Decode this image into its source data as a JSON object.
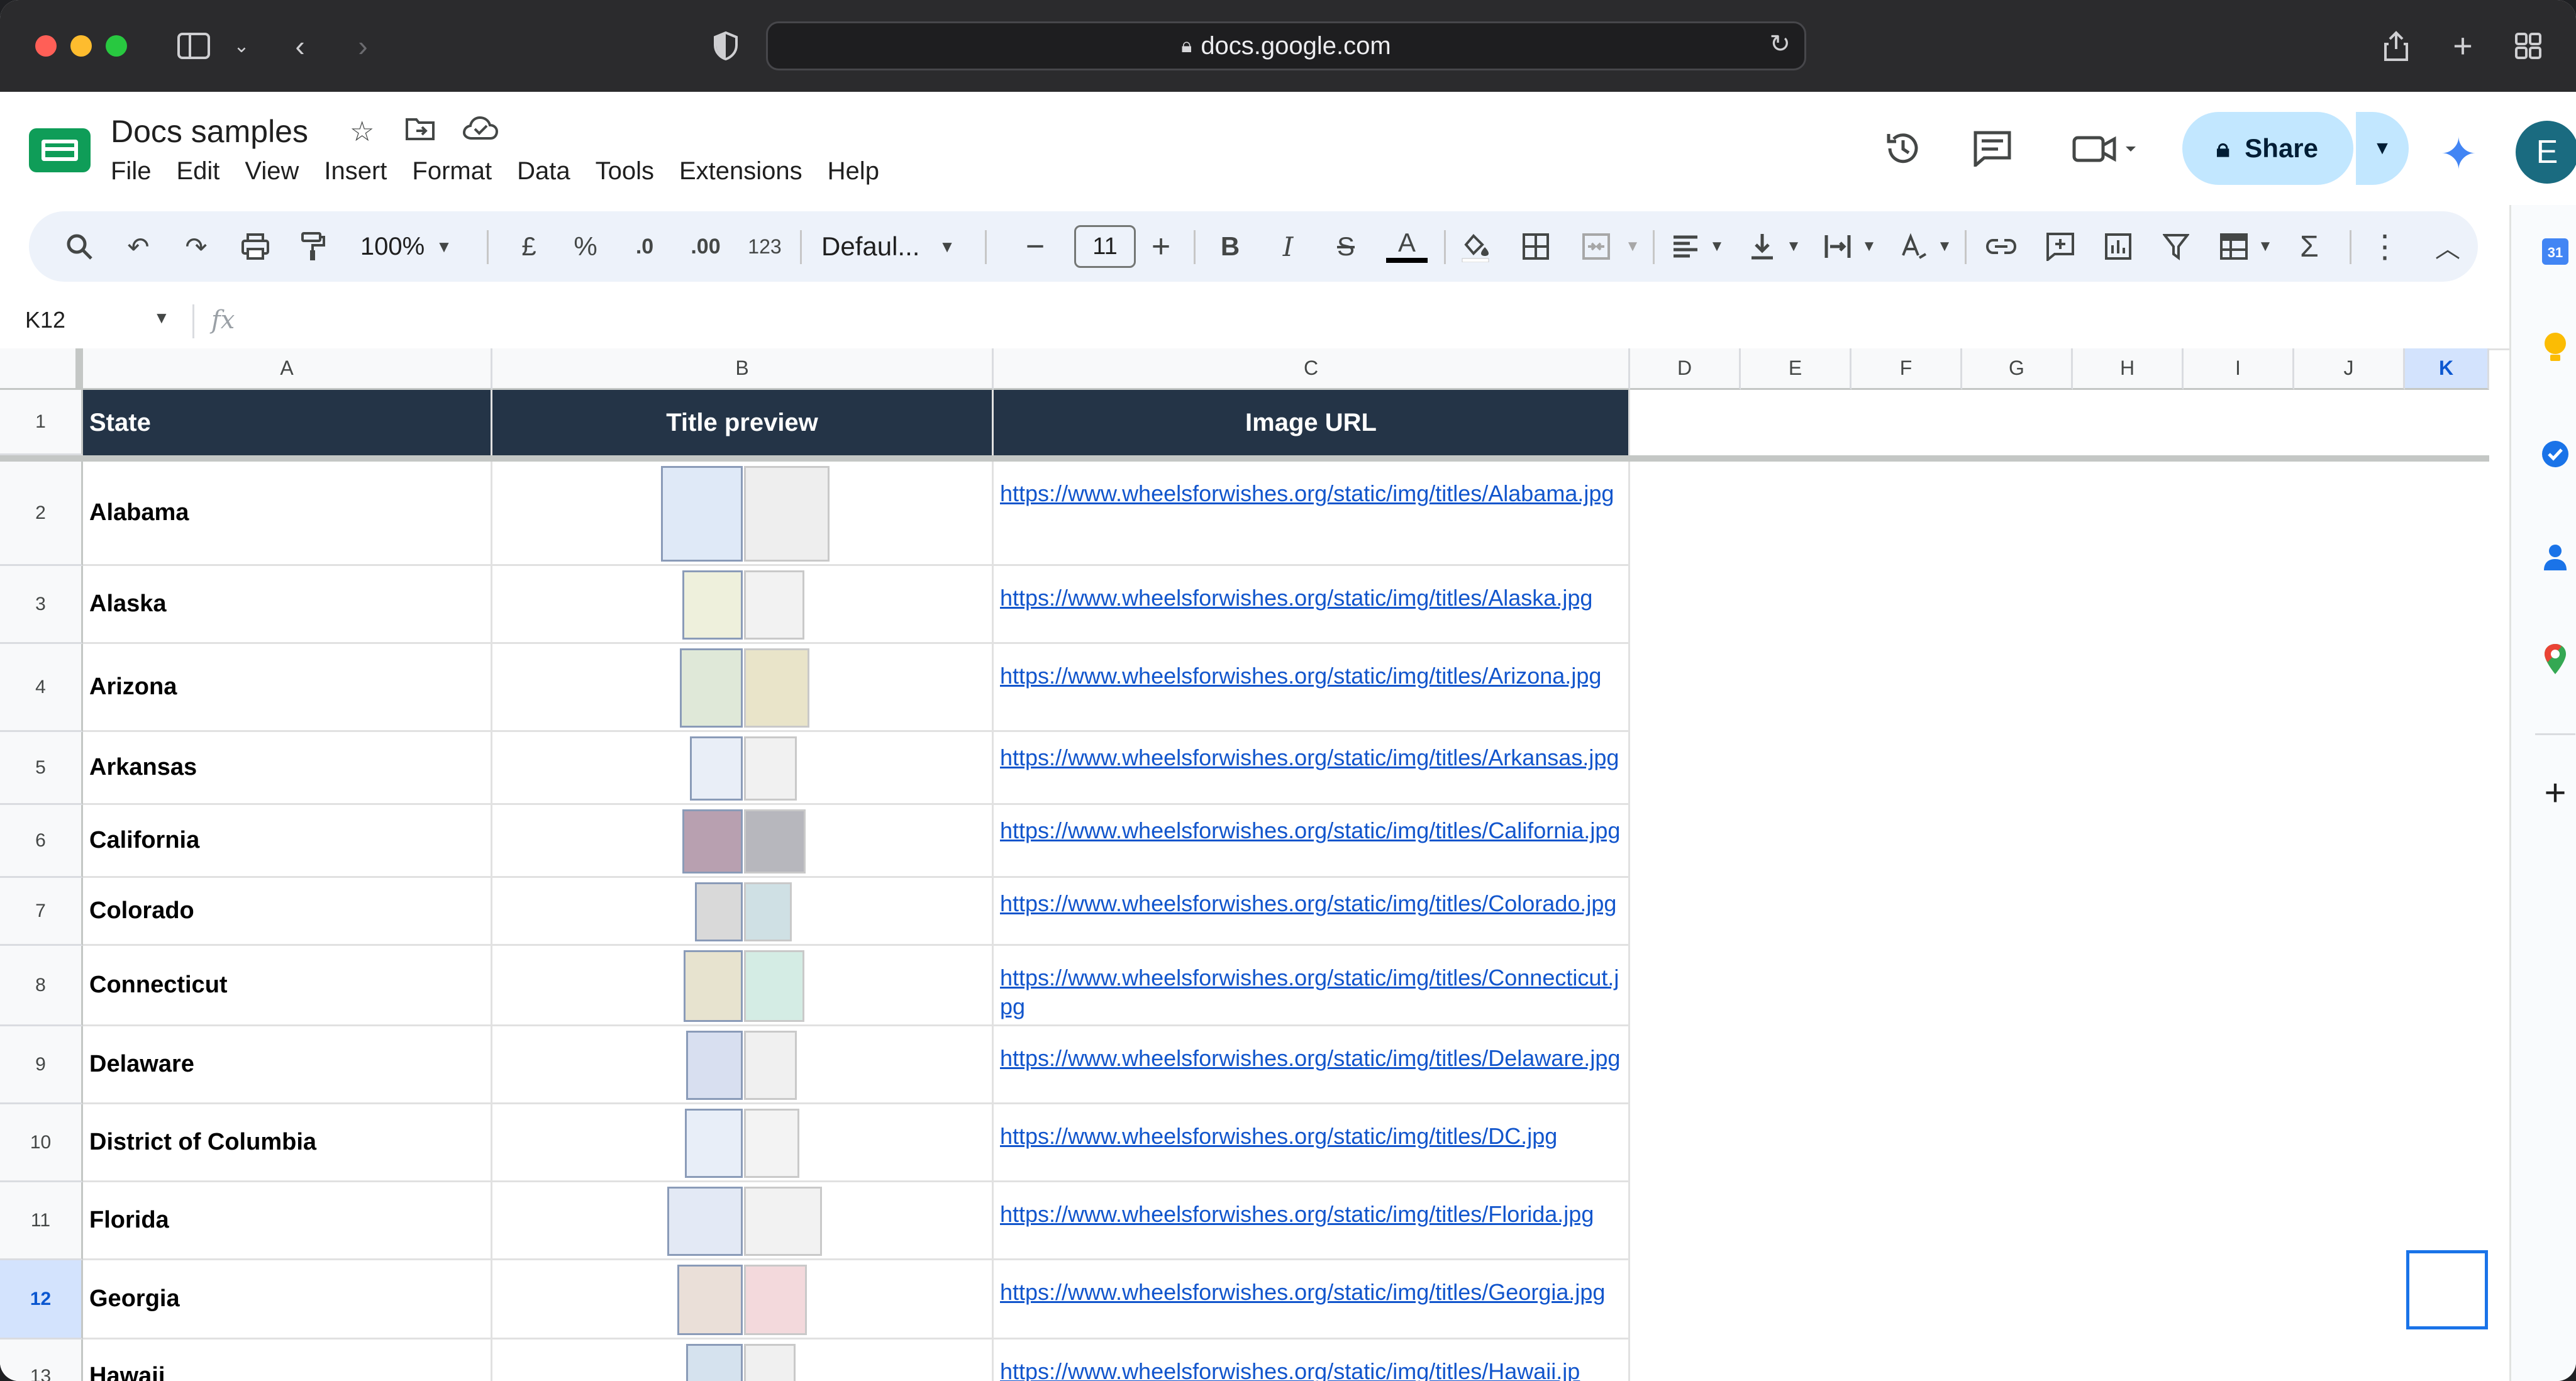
{
  "browser": {
    "url": "docs.google.com"
  },
  "app": {
    "doc_title": "Docs samples",
    "menu": [
      "File",
      "Edit",
      "View",
      "Insert",
      "Format",
      "Data",
      "Tools",
      "Extensions",
      "Help"
    ],
    "share_label": "Share",
    "avatar_letter": "E"
  },
  "toolbar": {
    "zoom": "100%",
    "currency": "£",
    "percent": "%",
    "dec_decrease": ".0",
    "dec_increase": ".00",
    "number_format": "123",
    "font": "Defaul...",
    "font_size": "11",
    "bold": "B",
    "italic": "I",
    "strike": "S",
    "text_color": "A",
    "sum": "Σ"
  },
  "formula_bar": {
    "name_box": "K12",
    "fx": "fx",
    "value": ""
  },
  "grid": {
    "columns": [
      "A",
      "B",
      "C",
      "D",
      "E",
      "F",
      "G",
      "H",
      "I",
      "J",
      "K"
    ],
    "selected_column": "K",
    "selected_row": "12",
    "header": {
      "row_num": "1",
      "state": "State",
      "title_preview": "Title preview",
      "image_url": "Image URL"
    },
    "rows": [
      {
        "num": "2",
        "state": "Alabama",
        "url": "https://www.wheelsforwishes.org/static/img/titles/Alabama.jpg"
      },
      {
        "num": "3",
        "state": "Alaska",
        "url": "https://www.wheelsforwishes.org/static/img/titles/Alaska.jpg"
      },
      {
        "num": "4",
        "state": "Arizona",
        "url": "https://www.wheelsforwishes.org/static/img/titles/Arizona.jpg"
      },
      {
        "num": "5",
        "state": "Arkansas",
        "url": "https://www.wheelsforwishes.org/static/img/titles/Arkansas.jpg"
      },
      {
        "num": "6",
        "state": "California",
        "url": "https://www.wheelsforwishes.org/static/img/titles/California.jpg"
      },
      {
        "num": "7",
        "state": "Colorado",
        "url": "https://www.wheelsforwishes.org/static/img/titles/Colorado.jpg"
      },
      {
        "num": "8",
        "state": "Connecticut",
        "url": "https://www.wheelsforwishes.org/static/img/titles/Connecticut.jpg"
      },
      {
        "num": "9",
        "state": "Delaware",
        "url": "https://www.wheelsforwishes.org/static/img/titles/Delaware.jpg"
      },
      {
        "num": "10",
        "state": "District of Columbia",
        "url": "https://www.wheelsforwishes.org/static/img/titles/DC.jpg"
      },
      {
        "num": "11",
        "state": "Florida",
        "url": "https://www.wheelsforwishes.org/static/img/titles/Florida.jpg"
      },
      {
        "num": "12",
        "state": "Georgia",
        "url": "https://www.wheelsforwishes.org/static/img/titles/Georgia.jpg"
      },
      {
        "num": "13",
        "state": "Hawaii",
        "url": "https://www.wheelsforwishes.org/static/img/titles/Hawaii.jp"
      }
    ]
  },
  "colors": {
    "header_fill": "#243447",
    "link": "#1155cc",
    "selection": "#1a73e8",
    "share_bg": "#c2e7ff"
  }
}
